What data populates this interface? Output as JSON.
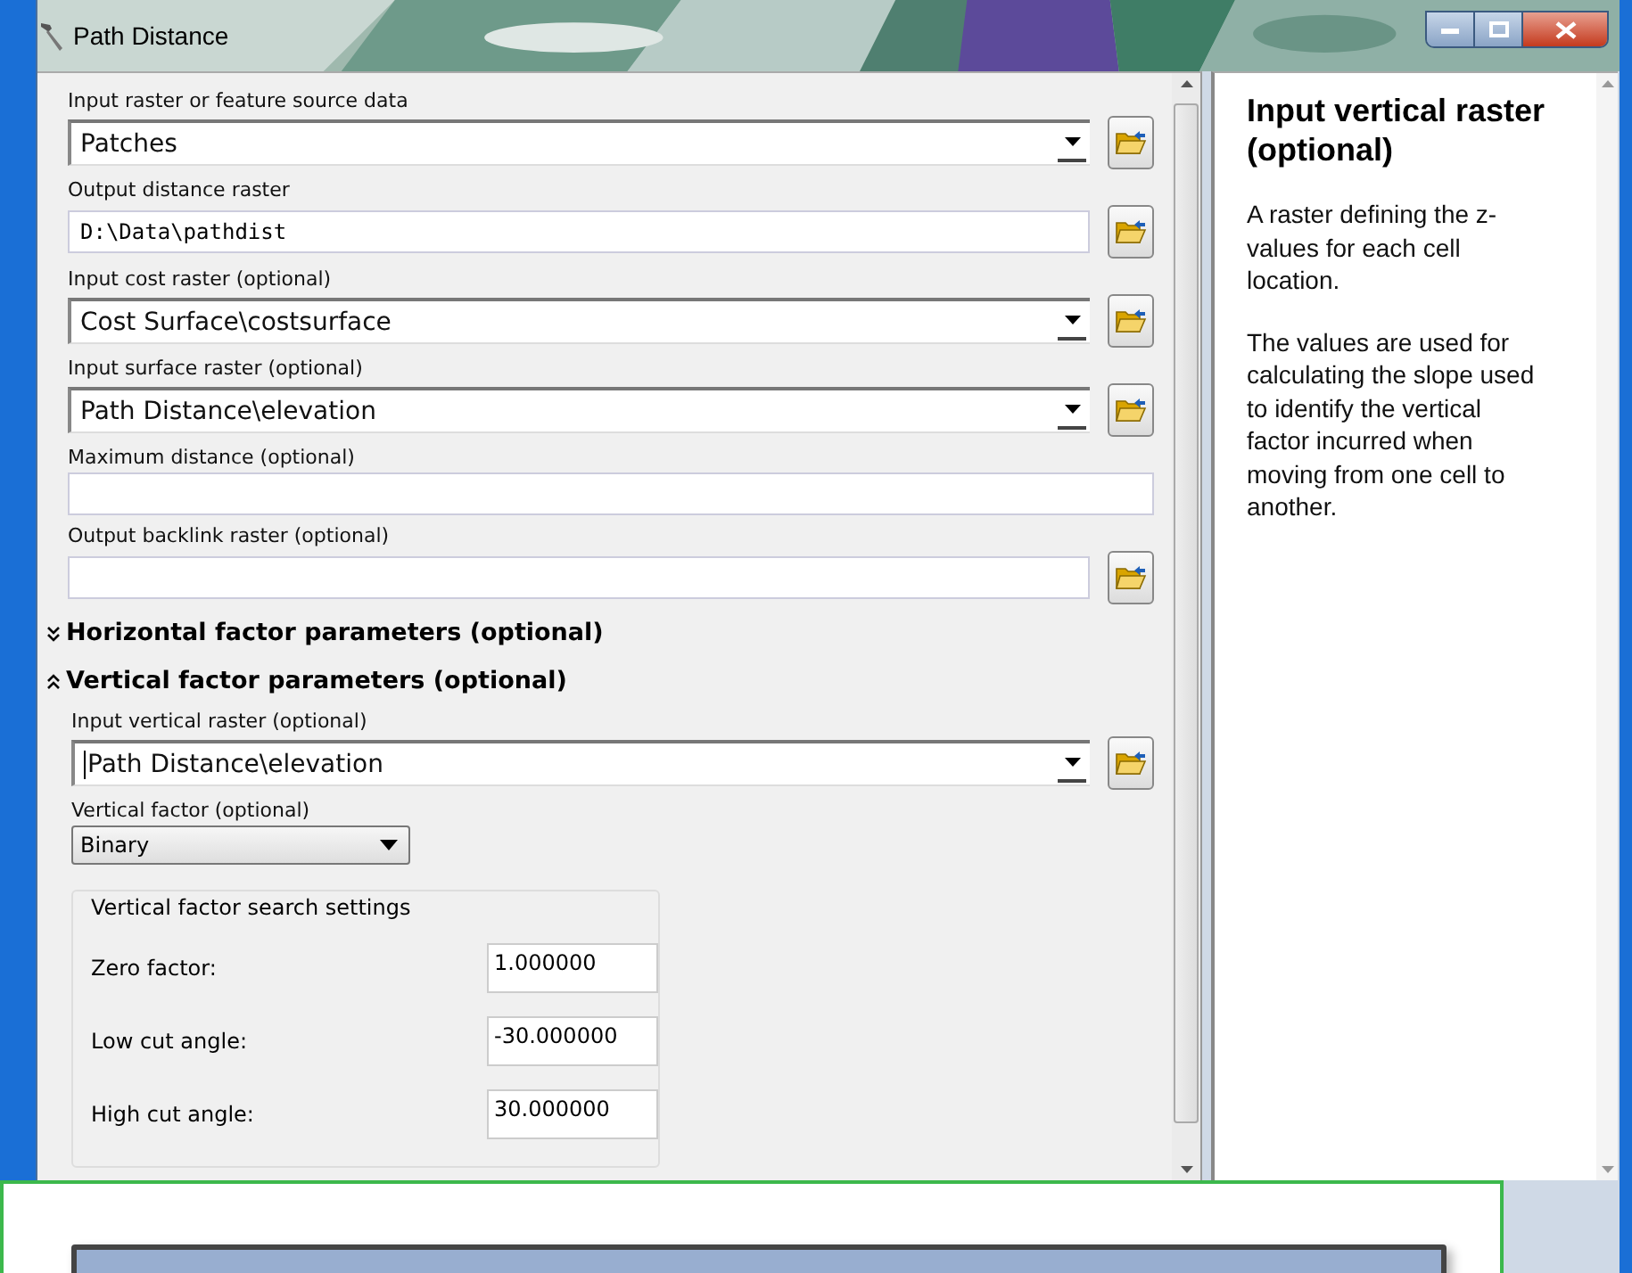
{
  "window": {
    "title": "Path Distance"
  },
  "params": [
    {
      "label": "Input raster or feature source data",
      "kind": "combo",
      "value": "Patches",
      "browse": true
    },
    {
      "label": "Output distance raster",
      "kind": "text",
      "value": "D:\\Data\\pathdist",
      "browse": true
    },
    {
      "label": "Input cost raster (optional)",
      "kind": "combo",
      "value": "Cost Surface\\costsurface",
      "browse": true
    },
    {
      "label": "Input surface raster (optional)",
      "kind": "combo",
      "value": "Path Distance\\elevation",
      "browse": true
    },
    {
      "label": "Maximum distance (optional)",
      "kind": "text",
      "browse": false
    },
    {
      "label": "Output backlink raster (optional)",
      "kind": "text",
      "browse": true
    }
  ],
  "sections": [
    {
      "title": "Horizontal factor parameters (optional)",
      "expanded": false
    },
    {
      "title": "Vertical factor parameters (optional)",
      "expanded": true,
      "params": [
        {
          "label": "Input vertical raster (optional)",
          "kind": "combo",
          "value": "Path Distance\\elevation",
          "browse": true,
          "focused": true
        },
        {
          "label": "Vertical factor (optional)",
          "kind": "select",
          "value": "Binary",
          "browse": false
        }
      ],
      "group": {
        "title": "Vertical factor search settings",
        "rows": [
          {
            "label": "Zero factor:",
            "value": "1.000000"
          },
          {
            "label": "Low cut angle:",
            "value": "-30.000000"
          },
          {
            "label": "High cut angle:",
            "value": "30.000000"
          }
        ]
      }
    }
  ],
  "help": {
    "title": "Input vertical raster (optional)",
    "paragraphs": [
      "A raster defining the z-values for each cell location.",
      "The values are used for calculating the slope used to identify the vertical factor incurred when moving from one cell to another."
    ]
  }
}
